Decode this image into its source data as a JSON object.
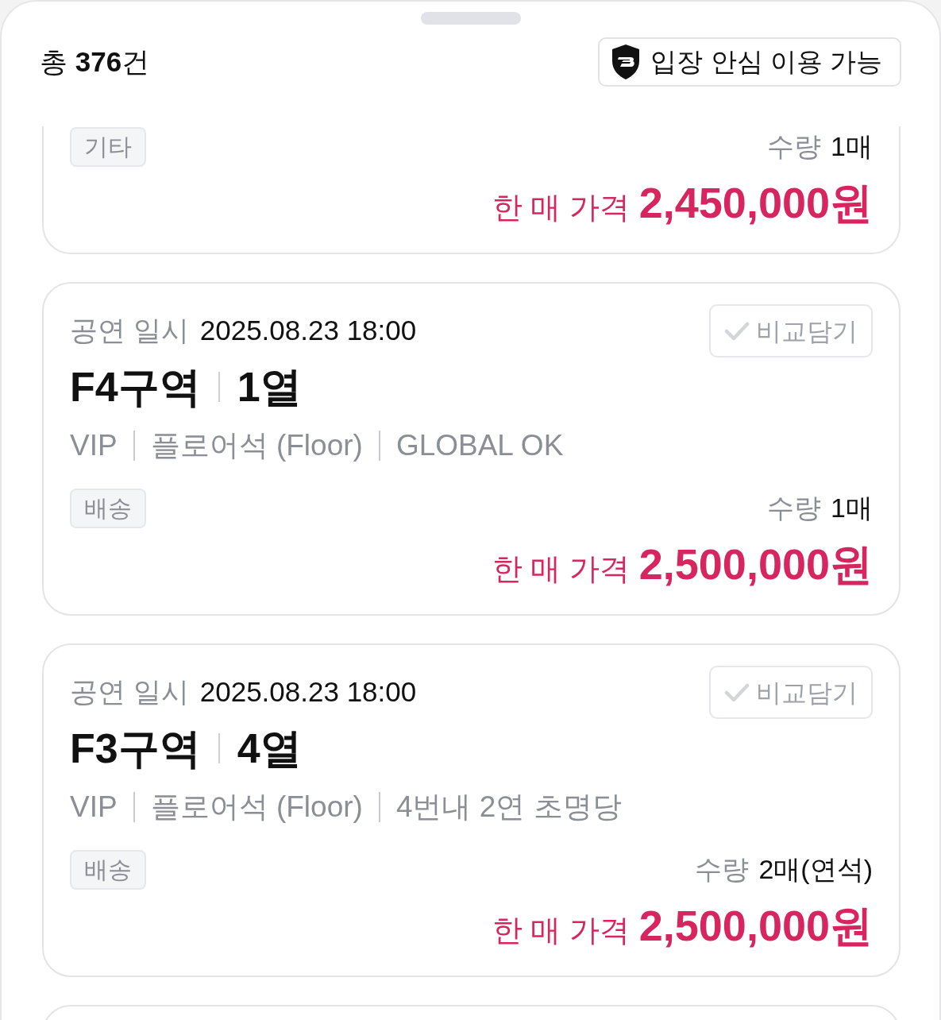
{
  "header": {
    "total": "총 **376**건",
    "safe_badge": "입장 안심 이용 가능"
  },
  "listings": [
    {
      "kind": "clipped",
      "tags": [
        "기타"
      ],
      "quantity_label": "수량",
      "quantity": "1매",
      "price_label": "한 매 가격",
      "price": "2,450,000원"
    },
    {
      "kind": "full",
      "date_label": "공연 일시",
      "date": "2025.08.23 18:00",
      "section": "F4구역",
      "row": "1열",
      "details": [
        "VIP",
        "플로어석 (Floor)",
        "GLOBAL OK"
      ],
      "compare": {
        "label": "비교담기",
        "checked": false
      },
      "tags": [
        "배송"
      ],
      "quantity_label": "수량",
      "quantity": "1매",
      "price_label": "한 매 가격",
      "price": "2,500,000원"
    },
    {
      "kind": "full",
      "date_label": "공연 일시",
      "date": "2025.08.23 18:00",
      "section": "F3구역",
      "row": "4열",
      "details": [
        "VIP",
        "플로어석 (Floor)",
        "4번내 2연 초명당"
      ],
      "compare": {
        "label": "비교담기",
        "checked": false
      },
      "tags": [
        "배송"
      ],
      "quantity_label": "수량",
      "quantity": "2매(연석)",
      "price_label": "한 매 가격",
      "price": "2,500,000원"
    },
    {
      "kind": "edge"
    }
  ]
}
